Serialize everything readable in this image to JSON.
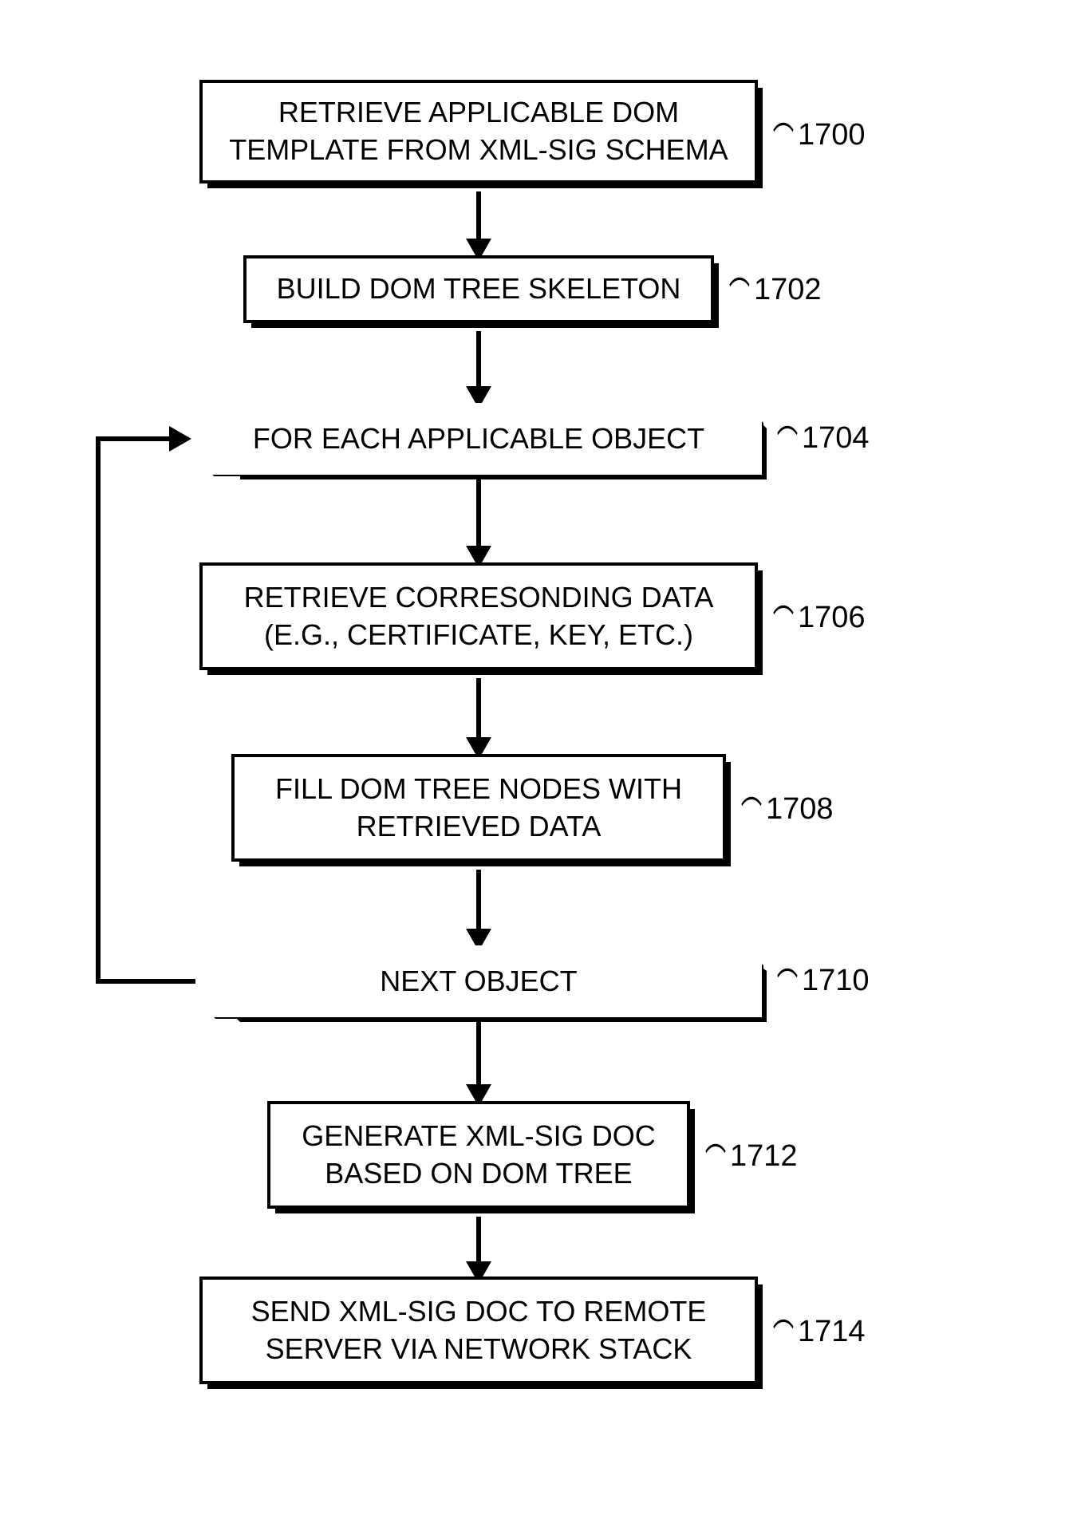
{
  "nodes": {
    "n1700": {
      "text": "RETRIEVE APPLICABLE DOM TEMPLATE FROM XML-SIG SCHEMA",
      "label": "1700"
    },
    "n1702": {
      "text": "BUILD DOM TREE SKELETON",
      "label": "1702"
    },
    "n1704": {
      "text": "FOR EACH APPLICABLE OBJECT",
      "label": "1704"
    },
    "n1706": {
      "text": "RETRIEVE CORRESONDING DATA (E.G., CERTIFICATE, KEY, ETC.)",
      "label": "1706"
    },
    "n1708": {
      "text": "FILL DOM TREE NODES WITH RETRIEVED DATA",
      "label": "1708"
    },
    "n1710": {
      "text": "NEXT OBJECT",
      "label": "1710"
    },
    "n1712": {
      "text": "GENERATE XML-SIG DOC BASED ON DOM TREE",
      "label": "1712"
    },
    "n1714": {
      "text": "SEND XML-SIG DOC TO REMOTE SERVER VIA NETWORK STACK",
      "label": "1714"
    }
  }
}
